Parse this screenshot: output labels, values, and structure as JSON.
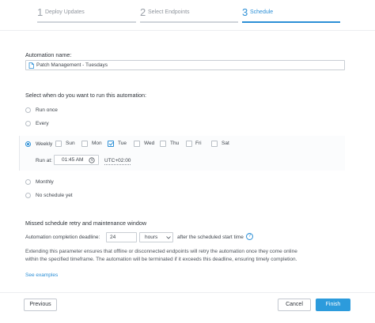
{
  "stepper": {
    "steps": [
      {
        "num": "1",
        "label": "Deploy Updates",
        "active": false
      },
      {
        "num": "2",
        "label": "Select Endpoints",
        "active": false
      },
      {
        "num": "3",
        "label": "Schedule",
        "active": true
      }
    ]
  },
  "automation": {
    "name_label": "Automation name:",
    "name_value": "Patch Management - Tuesdays"
  },
  "schedule": {
    "heading": "Select when do you want to run this automation:",
    "options": {
      "run_once": "Run once",
      "every": "Every",
      "weekly": "Weekly",
      "monthly": "Monthly",
      "no_schedule": "No schedule yet"
    },
    "selected": "weekly",
    "days": [
      {
        "label": "Sun",
        "checked": false
      },
      {
        "label": "Mon",
        "checked": false
      },
      {
        "label": "Tue",
        "checked": true
      },
      {
        "label": "Wed",
        "checked": false
      },
      {
        "label": "Thu",
        "checked": false
      },
      {
        "label": "Fri",
        "checked": false
      },
      {
        "label": "Sat",
        "checked": false
      }
    ],
    "run_at_label": "Run at:",
    "run_at_value": "01:45 AM",
    "timezone": "UTC+02:00"
  },
  "missed": {
    "heading": "Missed schedule retry and maintenance window",
    "deadline_label": "Automation completion deadline:",
    "deadline_value": "24",
    "deadline_unit": "hours",
    "deadline_suffix": "after the scheduled start time",
    "description": "Extending this parameter ensures that offline or disconnected endpoints will retry the automation once they come online within the specified timeframe. The automation will be terminated if it exceeds this deadline, ensuring timely completion.",
    "examples_link": "See examples"
  },
  "footer": {
    "previous": "Previous",
    "cancel": "Cancel",
    "finish": "Finish"
  },
  "colors": {
    "accent": "#2c8fd6",
    "primary_button": "#2c9bdc"
  }
}
